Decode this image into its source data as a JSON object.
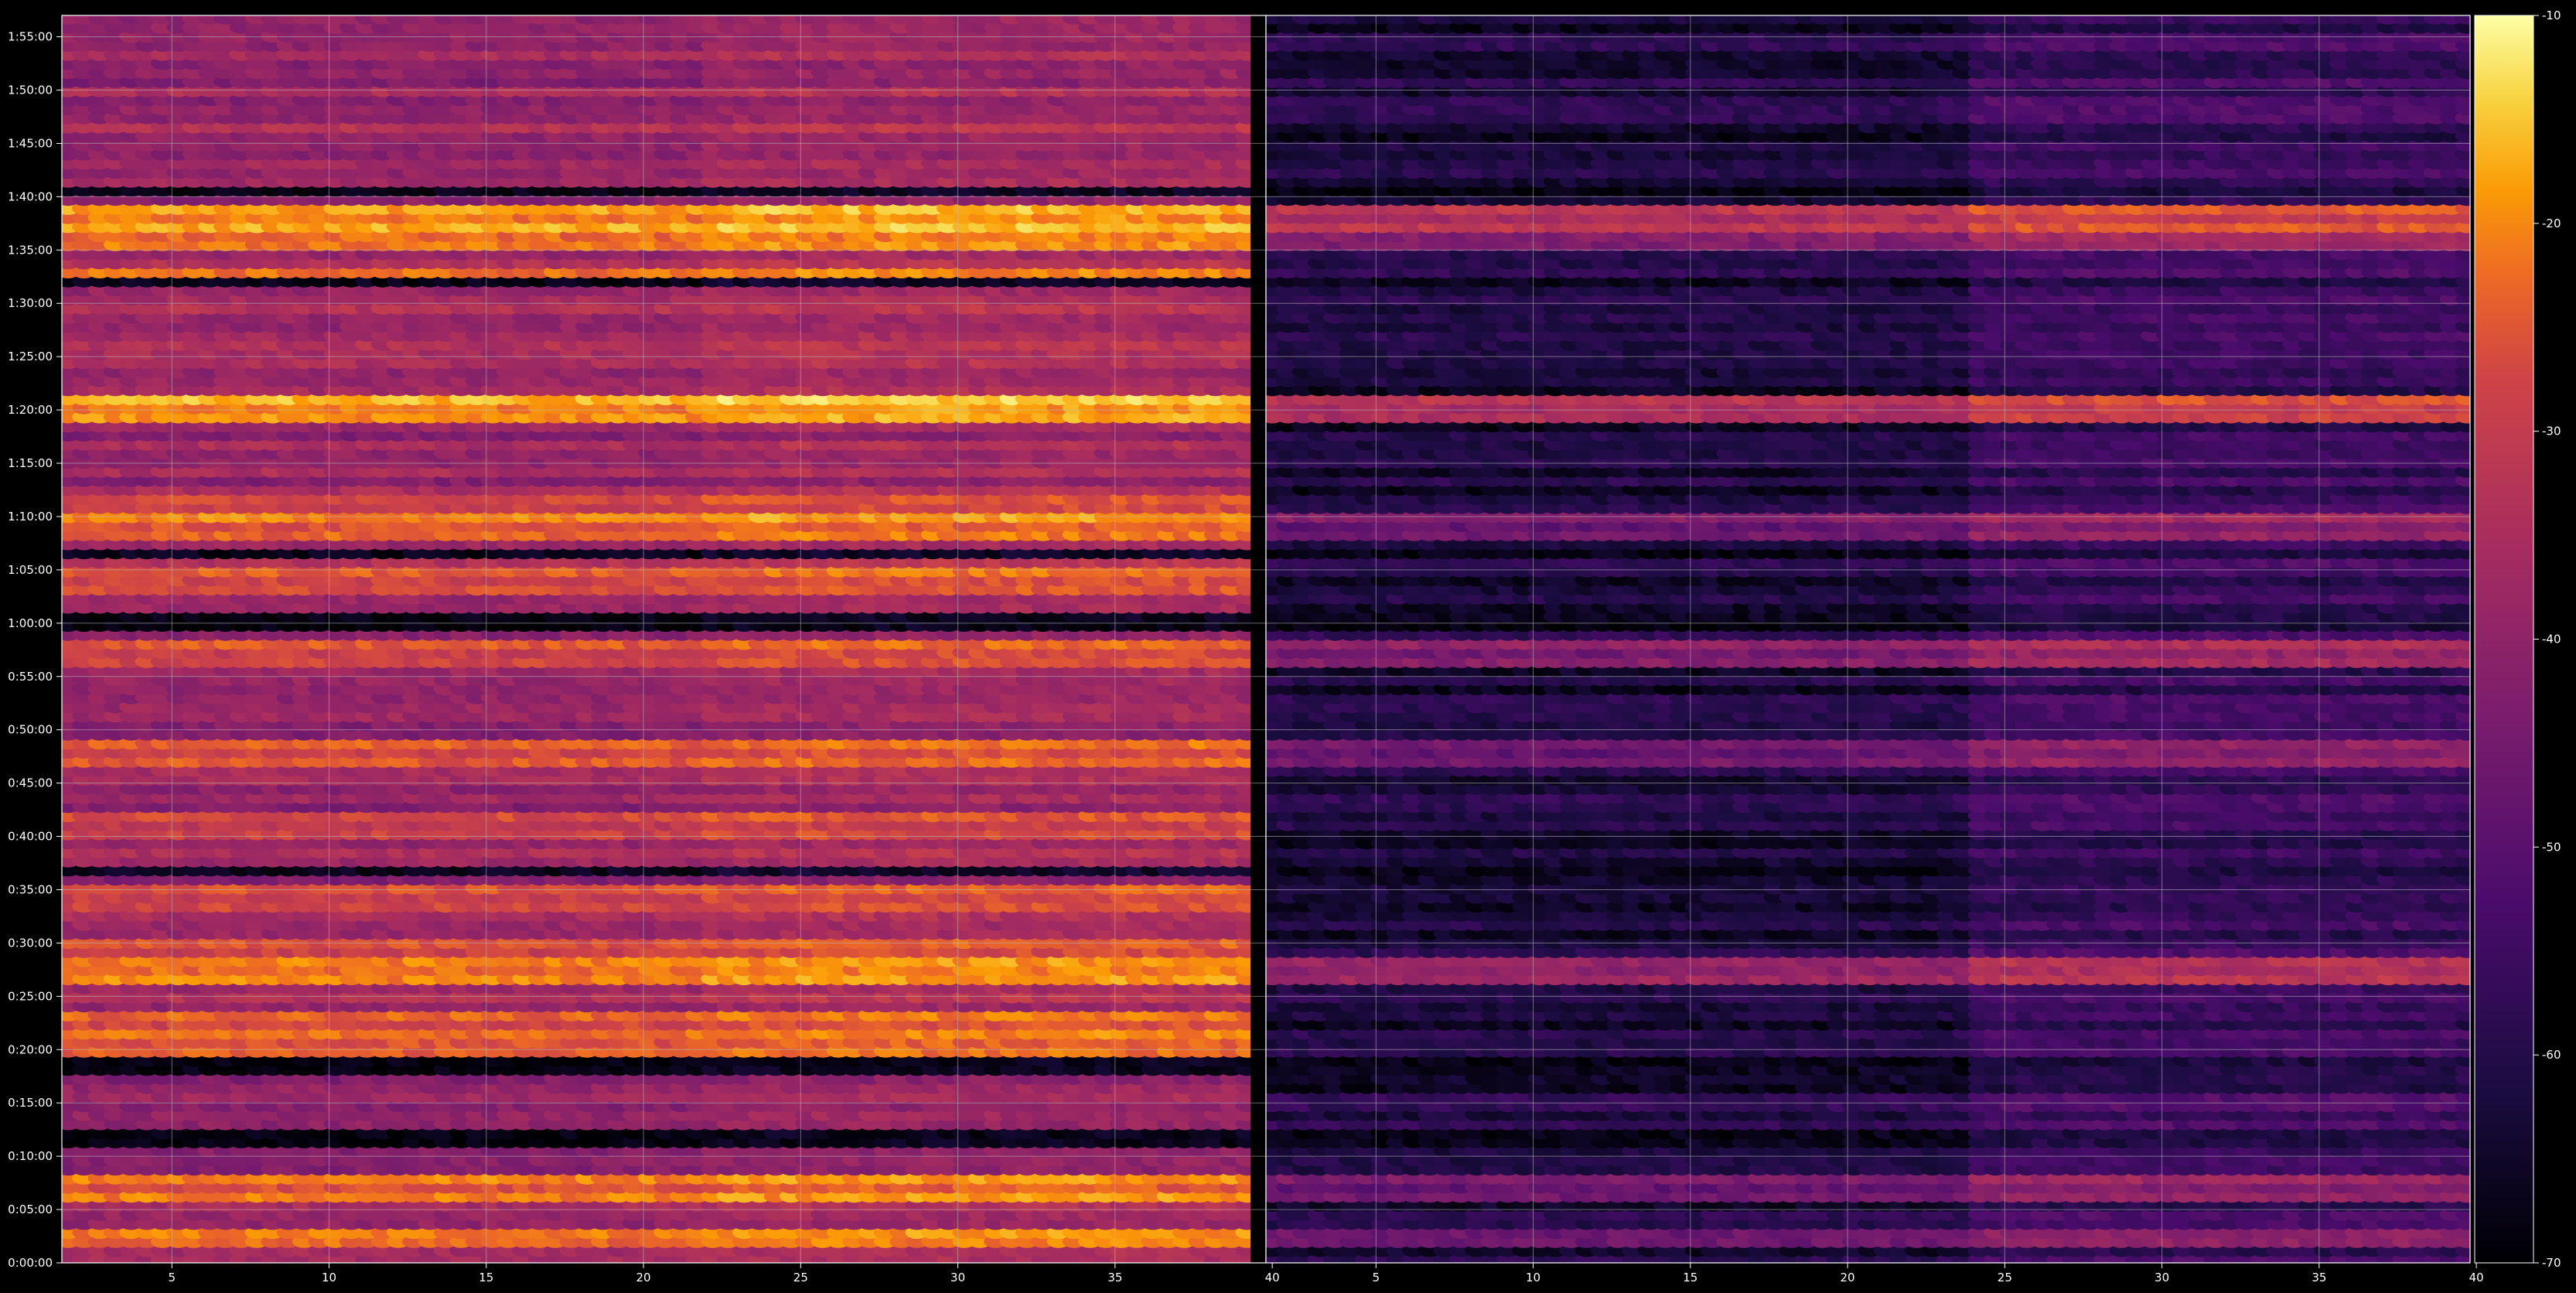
{
  "chart_data": [
    {
      "type": "heatmap",
      "panel": "left",
      "title": "",
      "xlabel": "",
      "ylabel": "",
      "xlim": [
        1.5,
        39.8
      ],
      "xticks": [
        5,
        10,
        15,
        20,
        25,
        30,
        35,
        40
      ],
      "xtick_labels": [
        "5",
        "10",
        "15",
        "20",
        "25",
        "30",
        "35",
        "40"
      ],
      "yticks_minutes": [
        0,
        5,
        10,
        15,
        20,
        25,
        30,
        35,
        40,
        45,
        50,
        55,
        60,
        65,
        70,
        75,
        80,
        85,
        90,
        95,
        100,
        105,
        110,
        115
      ],
      "ytick_labels": [
        "0:00:00",
        "0:05:00",
        "0:10:00",
        "0:15:00",
        "0:20:00",
        "0:25:00",
        "0:30:00",
        "0:35:00",
        "0:40:00",
        "0:45:00",
        "0:50:00",
        "0:55:00",
        "1:00:00",
        "1:05:00",
        "1:10:00",
        "1:15:00",
        "1:20:00",
        "1:25:00",
        "1:30:00",
        "1:35:00",
        "1:40:00",
        "1:45:00",
        "1:50:00",
        "1:55:00"
      ],
      "ylim_minutes": [
        0,
        117
      ],
      "grid": true,
      "colormap": "inferno",
      "baseline_dB": -38,
      "bright_rows": [
        {
          "time_min": 2.5,
          "value": -24
        },
        {
          "time_min": 7,
          "value": -26
        },
        {
          "time_min": 20.5,
          "value": -26
        },
        {
          "time_min": 22.5,
          "value": -28
        },
        {
          "time_min": 27.5,
          "value": -24
        },
        {
          "time_min": 29.5,
          "value": -30
        },
        {
          "time_min": 34,
          "value": -32
        },
        {
          "time_min": 41,
          "value": -32
        },
        {
          "time_min": 48,
          "value": -28
        },
        {
          "time_min": 57,
          "value": -30
        },
        {
          "time_min": 64,
          "value": -30
        },
        {
          "time_min": 69,
          "value": -26
        },
        {
          "time_min": 71,
          "value": -30
        },
        {
          "time_min": 80,
          "value": -22
        },
        {
          "time_min": 92.5,
          "value": -26
        },
        {
          "time_min": 96,
          "value": -24
        },
        {
          "time_min": 98,
          "value": -22
        }
      ],
      "dark_rows_min": [
        11.5,
        18.5,
        37,
        60.5,
        66.5,
        92,
        100.5
      ]
    },
    {
      "type": "heatmap",
      "panel": "right",
      "title": "",
      "xlabel": "",
      "ylabel": "",
      "xlim": [
        1.5,
        39.8
      ],
      "xticks": [
        5,
        10,
        15,
        20,
        25,
        30,
        35,
        40
      ],
      "xtick_labels": [
        "5",
        "10",
        "15",
        "20",
        "25",
        "30",
        "35",
        "40"
      ],
      "ylim_minutes": [
        0,
        117
      ],
      "grid": true,
      "colormap": "inferno",
      "baseline_dB": -62,
      "bright_rows": [
        {
          "time_min": 2.5,
          "value": -48
        },
        {
          "time_min": 7,
          "value": -48
        },
        {
          "time_min": 27.5,
          "value": -42
        },
        {
          "time_min": 48,
          "value": -50
        },
        {
          "time_min": 57,
          "value": -46
        },
        {
          "time_min": 69,
          "value": -48
        },
        {
          "time_min": 80,
          "value": -38
        },
        {
          "time_min": 96,
          "value": -44
        },
        {
          "time_min": 98,
          "value": -36
        }
      ],
      "dark_rows_min": [
        11.5,
        18.5,
        37,
        60.5,
        66.5,
        92,
        100.5
      ]
    }
  ],
  "colorbar": {
    "cmap": "inferno",
    "vmin": -70,
    "vmax": -10,
    "ticks": [
      -10,
      -20,
      -30,
      -40,
      -50,
      -60,
      -70
    ],
    "tick_labels": [
      "-10",
      "-20",
      "-30",
      "-40",
      "-50",
      "-60",
      "-70"
    ]
  },
  "colors": {
    "background": "#000000",
    "grid": "#bbbbbb",
    "text": "#ffffff",
    "axes_edge": "#ffffff"
  }
}
